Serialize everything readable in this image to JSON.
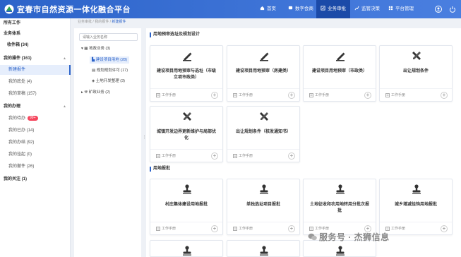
{
  "header": {
    "app_title": "宜春市自然资源一体化融合平台",
    "nav": [
      {
        "label": "首页",
        "icon": "home-icon"
      },
      {
        "label": "数字会商",
        "icon": "chat-icon"
      },
      {
        "label": "业务审批",
        "icon": "approval-icon",
        "active": true
      },
      {
        "label": "监管决策",
        "icon": "chart-icon"
      },
      {
        "label": "平台管理",
        "icon": "grid-icon"
      }
    ],
    "colors": {
      "bar": "#2c63c9",
      "active": "#1b4aa8"
    }
  },
  "sidebar": {
    "items": [
      {
        "label": "所有工作",
        "level": 0
      },
      {
        "label": "业务体系",
        "level": 0
      },
      {
        "label": "收件箱 (34)",
        "level": 0
      },
      {
        "label": "我的操件 (161)",
        "level": 0,
        "expanded": true
      },
      {
        "label": "新建报件",
        "level": 1,
        "selected": true
      },
      {
        "label": "我的底处 (4)",
        "level": 1
      },
      {
        "label": "我的草稿 (157)",
        "level": 1
      },
      {
        "label": "我的办理",
        "level": 0,
        "expanded": true
      },
      {
        "label": "我的待办",
        "level": 1,
        "badge": "99+"
      },
      {
        "label": "我的已办 (14)",
        "level": 1
      },
      {
        "label": "我的办结 (92)",
        "level": 1
      },
      {
        "label": "我的挂起 (0)",
        "level": 1
      },
      {
        "label": "我的撤件 (26)",
        "level": 1
      },
      {
        "label": "我的关注 (1)",
        "level": 0
      }
    ]
  },
  "breadcrumb": {
    "parts": [
      "业务审批",
      "我的报件"
    ],
    "current": "新建报件"
  },
  "tree": {
    "search_placeholder": "请输入业务名称",
    "nodes": [
      {
        "label": "地政业务 (3)",
        "level": 0
      },
      {
        "label": "建设项目用地 (28)",
        "level": 1,
        "selected": true
      },
      {
        "label": "规划规划许可 (17)",
        "level": 1
      },
      {
        "label": "土地开发整理 (3)",
        "level": 1
      },
      {
        "label": "矿政业务 (2)",
        "level": 0
      }
    ]
  },
  "sections": [
    {
      "title": "用地预审选址及规划设计"
    },
    {
      "title": "用地报批"
    }
  ],
  "cards": [
    {
      "title": "建设项目用地预审与选址（市级立项市政类）",
      "icon": "stamp-pen-icon",
      "foot": "工作手册"
    },
    {
      "title": "建设项目用地预审（房建类）",
      "icon": "stamp-pen-icon",
      "foot": "工作手册"
    },
    {
      "title": "建设项目用地预审（市政类）",
      "icon": "stamp-pen-icon",
      "foot": "工作手册"
    },
    {
      "title": "出让规划条件",
      "icon": "ruler-pencil-icon",
      "foot": "工作手册"
    },
    {
      "title": "城镇开发边界更新维护与局部优化",
      "icon": "ruler-pencil-icon",
      "foot": "工作手册"
    },
    {
      "title": "出让规划条件（核发通知书）",
      "icon": "ruler-pencil-icon",
      "foot": "工作手册"
    },
    {
      "title": "村庄集体建设用地报批",
      "icon": "seal-icon",
      "foot": "工作手册"
    },
    {
      "title": "单独选址项目报批",
      "icon": "seal-icon",
      "foot": "工作手册"
    },
    {
      "title": "土地征收和农用地转用分批次报批",
      "icon": "seal-icon",
      "foot": "工作手册"
    },
    {
      "title": "城乡增减挂钩用地报批",
      "icon": "seal-icon",
      "foot": "工作手册"
    }
  ],
  "watermark": "服务号 · 杰狮信息"
}
